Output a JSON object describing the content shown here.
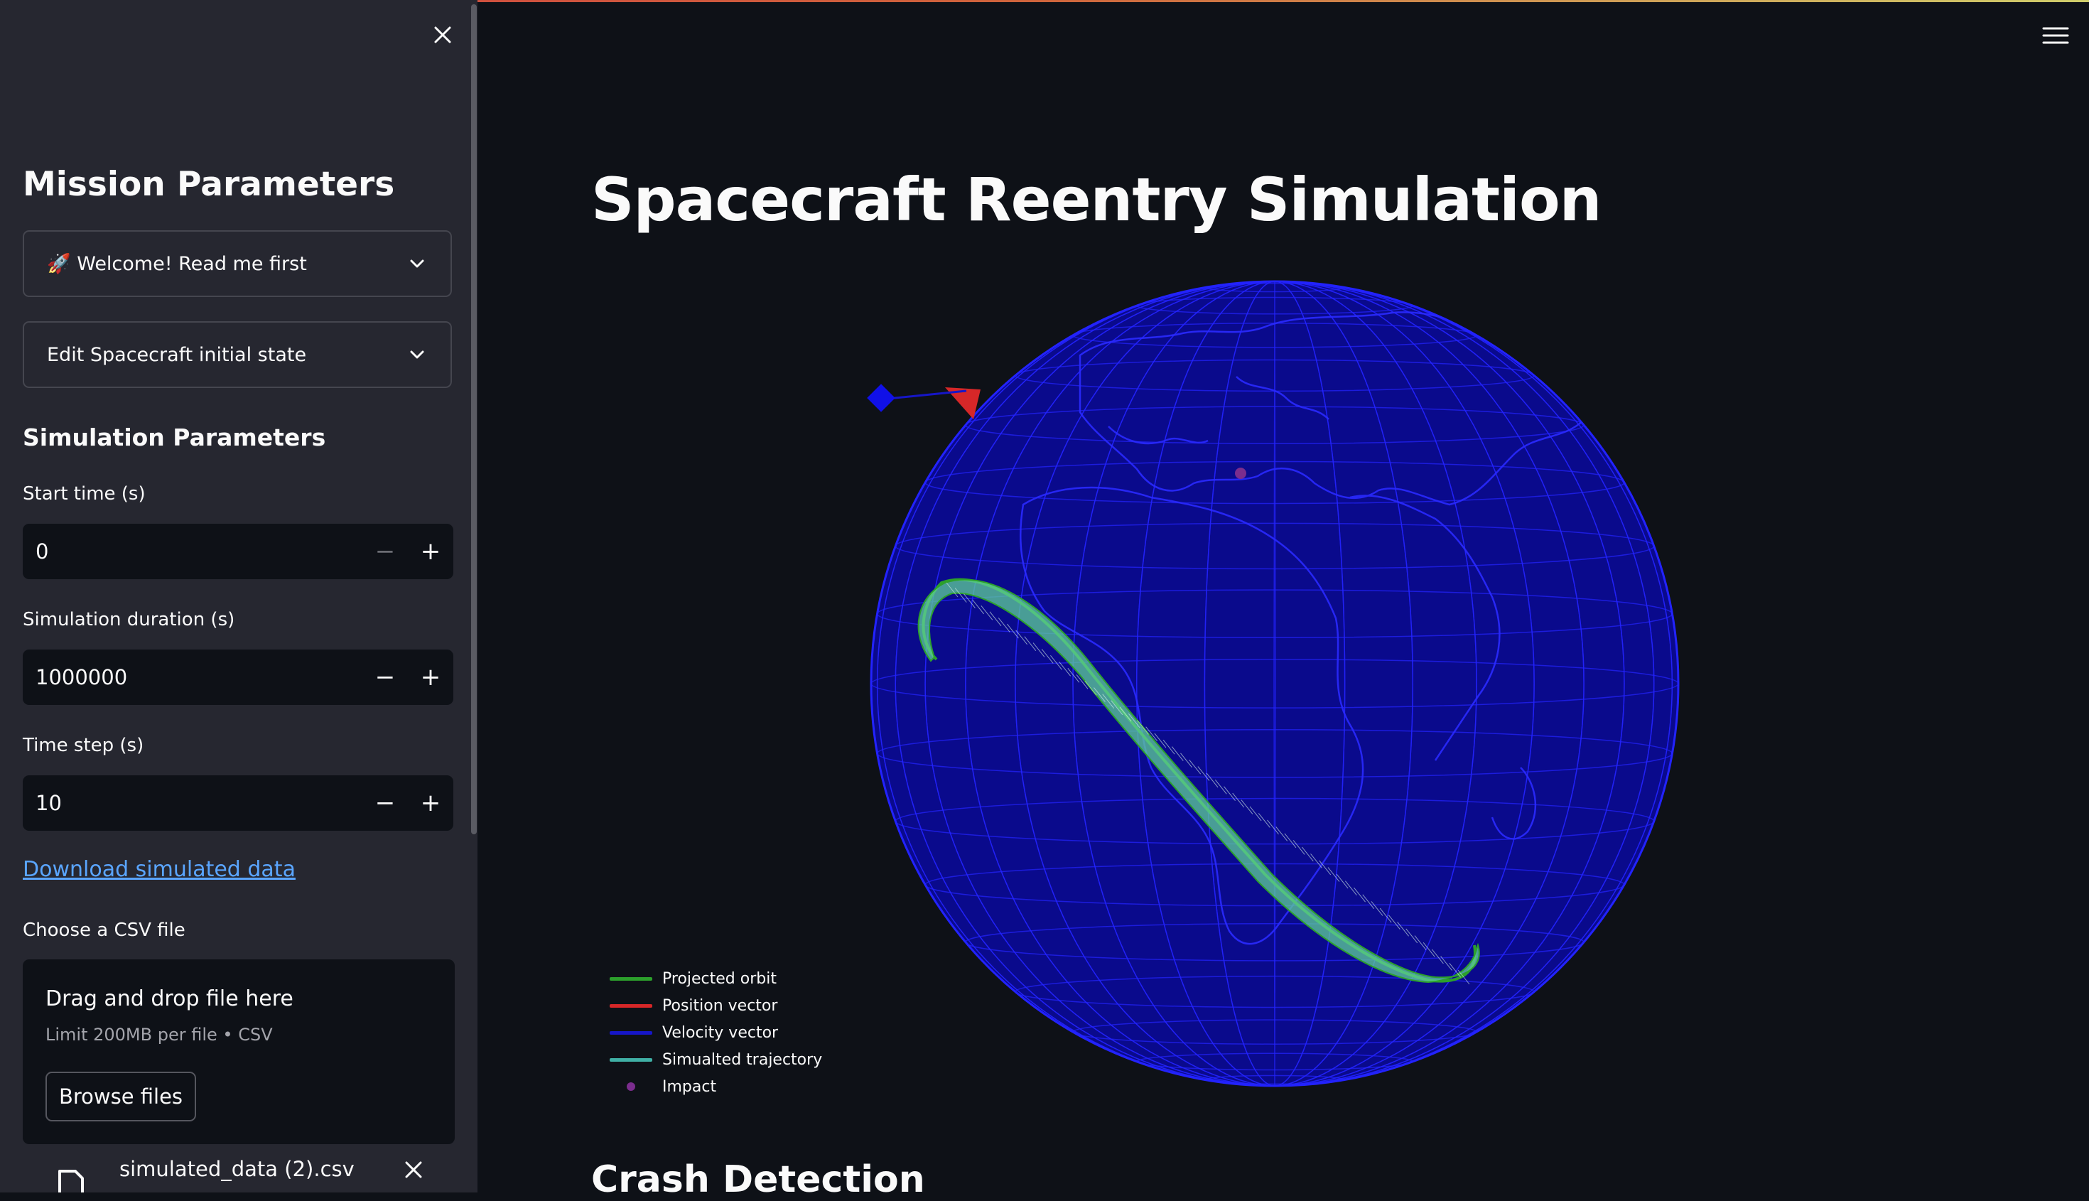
{
  "sidebar": {
    "title": "Mission Parameters",
    "expanders": [
      {
        "label": "🚀 Welcome! Read me first"
      },
      {
        "label": "Edit Spacecraft initial state"
      }
    ],
    "section_title": "Simulation Parameters",
    "inputs": [
      {
        "label": "Start time (s)",
        "value": "0"
      },
      {
        "label": "Simulation duration (s)",
        "value": "1000000"
      },
      {
        "label": "Time step (s)",
        "value": "10"
      }
    ],
    "download_link": "Download simulated data",
    "uploader": {
      "label": "Choose a CSV file",
      "title": "Drag and drop file here",
      "limit": "Limit 200MB per file • CSV",
      "browse_label": "Browse files",
      "file_name": "simulated_data (2).csv"
    }
  },
  "main": {
    "title": "Spacecraft Reentry Simulation",
    "next_section": "Crash Detection"
  },
  "plot": {
    "legend": [
      {
        "name": "Projected orbit",
        "color": "#2ca02c"
      },
      {
        "name": "Position vector",
        "color": "#d62728"
      },
      {
        "name": "Velocity vector",
        "color": "#1616c8"
      },
      {
        "name": "Simualted trajectory",
        "color": "#40b0a6"
      },
      {
        "name": "Impact",
        "color": "#7b2d8e"
      }
    ],
    "globe_color": "#0a0a8c",
    "grid_color": "#2323ff"
  },
  "icons": {
    "close": "close-icon",
    "chevron": "chevron-down-icon",
    "menu": "hamburger-menu-icon",
    "file": "file-icon"
  }
}
